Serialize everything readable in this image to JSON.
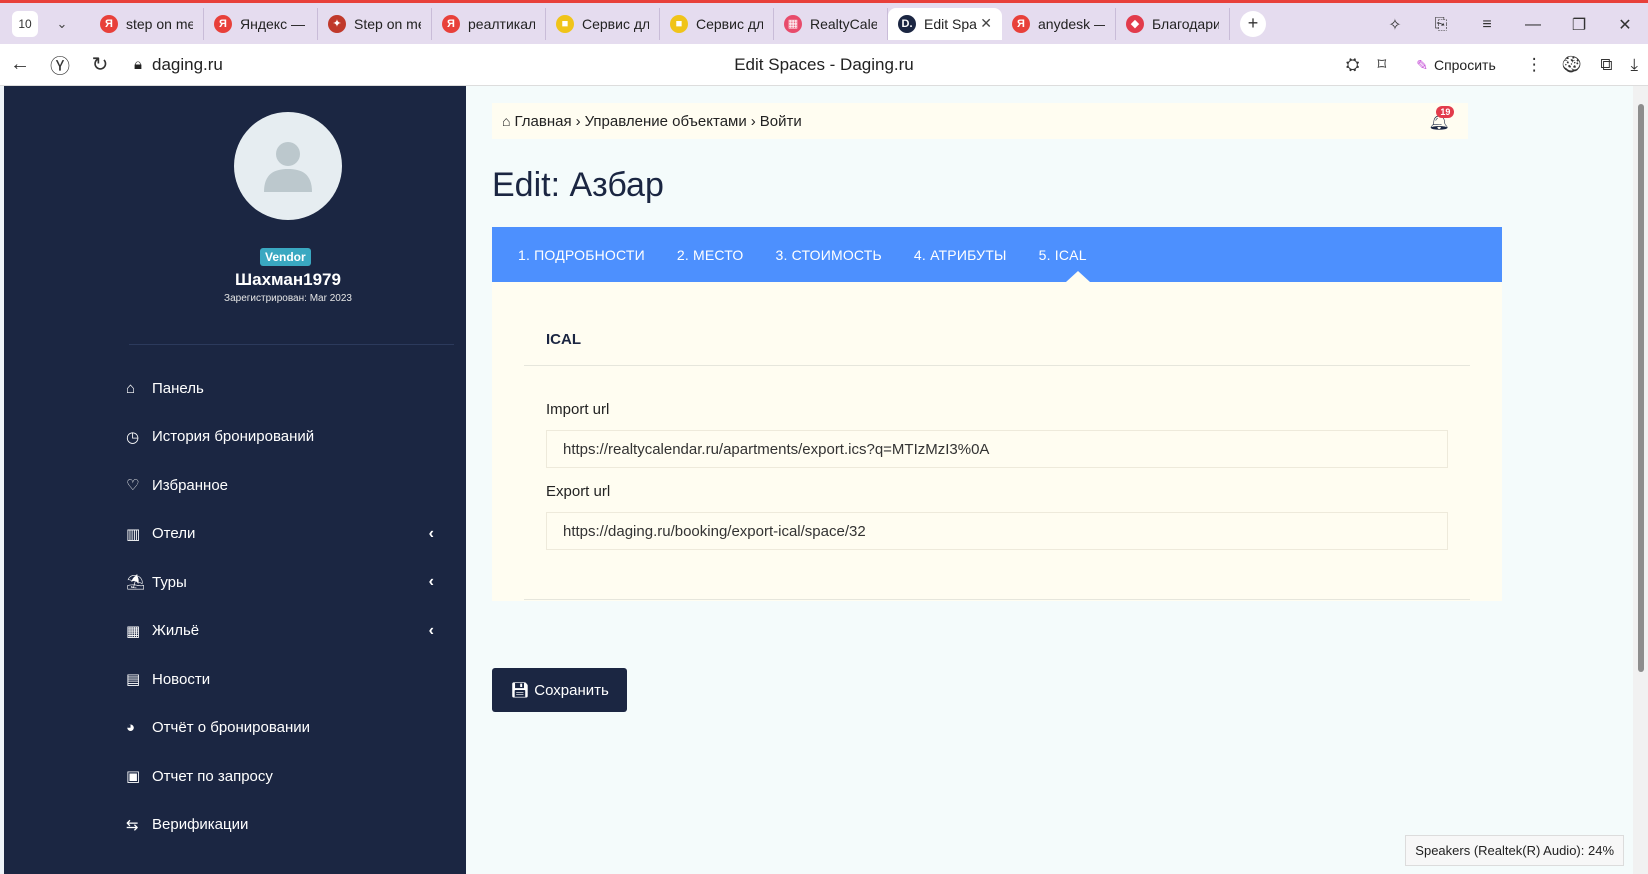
{
  "browser": {
    "tab_count": "10",
    "tabs": [
      {
        "title": "step on me",
        "fav": "Я",
        "color": "#e8403a"
      },
      {
        "title": "Яндекс — б",
        "fav": "Я",
        "color": "#e8403a"
      },
      {
        "title": "Step on me",
        "fav": "✦",
        "color": "#c0392b"
      },
      {
        "title": "реалтикал",
        "fav": "Я",
        "color": "#e8403a"
      },
      {
        "title": "Сервис для",
        "fav": "■",
        "color": "#f0c419"
      },
      {
        "title": "Сервис для",
        "fav": "■",
        "color": "#f0c419"
      },
      {
        "title": "RealtyCale",
        "fav": "▦",
        "color": "#e84b6b"
      },
      {
        "title": "Edit Spa",
        "fav": "D.",
        "color": "#1b2642",
        "active": true
      },
      {
        "title": "anydesk —",
        "fav": "Я",
        "color": "#e8403a"
      },
      {
        "title": "Благодари",
        "fav": "◆",
        "color": "#e23b4b"
      }
    ],
    "url": "daging.ru",
    "page_title": "Edit Spaces - Daging.ru",
    "ask_label": "Спросить"
  },
  "sidebar": {
    "badge": "Vendor",
    "username": "Шахман1979",
    "registered": "Зарегистрирован: Mar 2023",
    "items": [
      {
        "label": "Панель",
        "icon": "⌂",
        "chevron": false
      },
      {
        "label": "История бронирований",
        "icon": "◷",
        "chevron": false
      },
      {
        "label": "Избранное",
        "icon": "♡",
        "chevron": false
      },
      {
        "label": "Отели",
        "icon": "▥",
        "chevron": true
      },
      {
        "label": "Туры",
        "icon": "⛱",
        "chevron": true
      },
      {
        "label": "Жильё",
        "icon": "▦",
        "chevron": true
      },
      {
        "label": "Новости",
        "icon": "▤",
        "chevron": false
      },
      {
        "label": "Отчёт о бронировании",
        "icon": "◕",
        "chevron": false
      },
      {
        "label": "Отчет по запросу",
        "icon": "▣",
        "chevron": false
      },
      {
        "label": "Верификации",
        "icon": "⇆",
        "chevron": false
      }
    ]
  },
  "breadcrumb": {
    "home": "Главная",
    "items": [
      "Управление объектами",
      "Войти"
    ],
    "notifications": "19"
  },
  "page": {
    "heading": "Edit: Азбар",
    "tabs": [
      "1. ПОДРОБНОСТИ",
      "2. МЕСТО",
      "3. СТОИМОСТЬ",
      "4. АТРИБУТЫ",
      "5. ICAL"
    ],
    "panel_title": "ICAL",
    "import_label": "Import url",
    "import_value": "https://realtycalendar.ru/apartments/export.ics?q=MTIzMzI3%0A",
    "export_label": "Export url",
    "export_value": "https://daging.ru/booking/export-ical/space/32",
    "save_label": "Сохранить"
  },
  "toast": "Speakers (Realtek(R) Audio): 24%"
}
